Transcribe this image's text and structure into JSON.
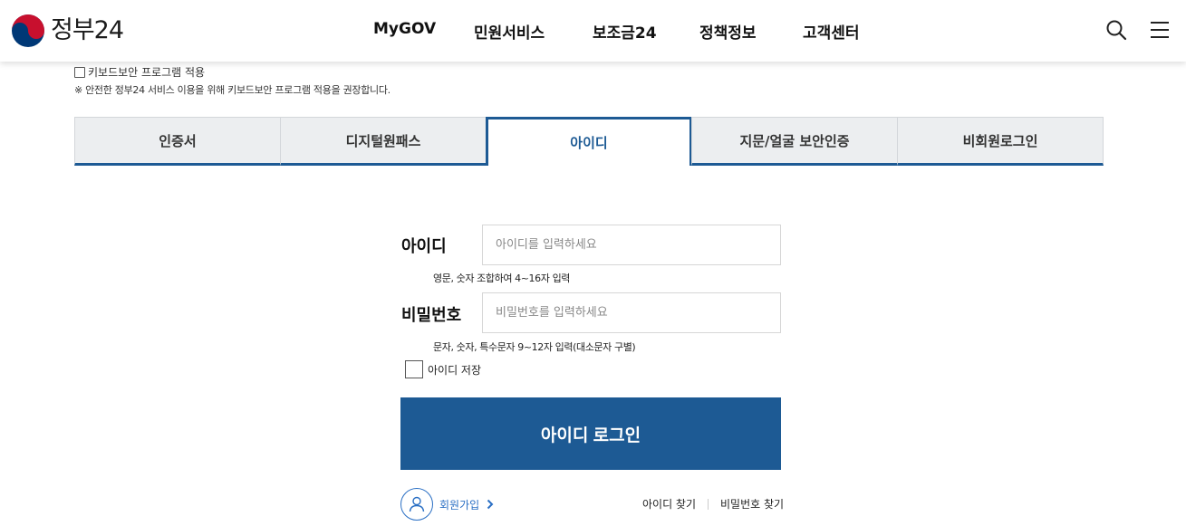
{
  "header": {
    "logo_text": "정부24",
    "nav": [
      "MyGOV",
      "민원서비스",
      "보조금24",
      "정책정보",
      "고객센터"
    ],
    "colors": {
      "brand_red": "#c8102e",
      "brand_blue": "#003876"
    }
  },
  "keyboard_security": {
    "checkbox_label": "키보드보안 프로그램 적용",
    "note": "※ 안전한 정부24 서비스 이용을 위해 키보드보안 프로그램 적용을 권장합니다."
  },
  "tabs": [
    {
      "label": "인증서",
      "active": false
    },
    {
      "label": "디지털원패스",
      "active": false
    },
    {
      "label": "아이디",
      "active": true
    },
    {
      "label": "지문/얼굴 보안인증",
      "active": false
    },
    {
      "label": "비회원로그인",
      "active": false
    }
  ],
  "form": {
    "id_label": "아이디",
    "id_placeholder": "아이디를 입력하세요",
    "id_hint": "영문, 숫자 조합하여 4~16자 입력",
    "pw_label": "비밀번호",
    "pw_placeholder": "비밀번호를 입력하세요",
    "pw_hint": "문자, 숫자, 특수문자 9~12자 입력(대소문자 구별)",
    "save_id_label": "아이디 저장",
    "login_button": "아이디 로그인",
    "signup_label": "회원가입",
    "find_id": "아이디 찾기",
    "find_password": "비밀번호 찾기"
  },
  "theme": {
    "primary": "#1d5a94",
    "link": "#2a6fc4"
  },
  "icons": {
    "search": "search-icon",
    "menu": "hamburger-menu-icon",
    "user": "user-icon",
    "chevron": "chevron-right-icon"
  }
}
